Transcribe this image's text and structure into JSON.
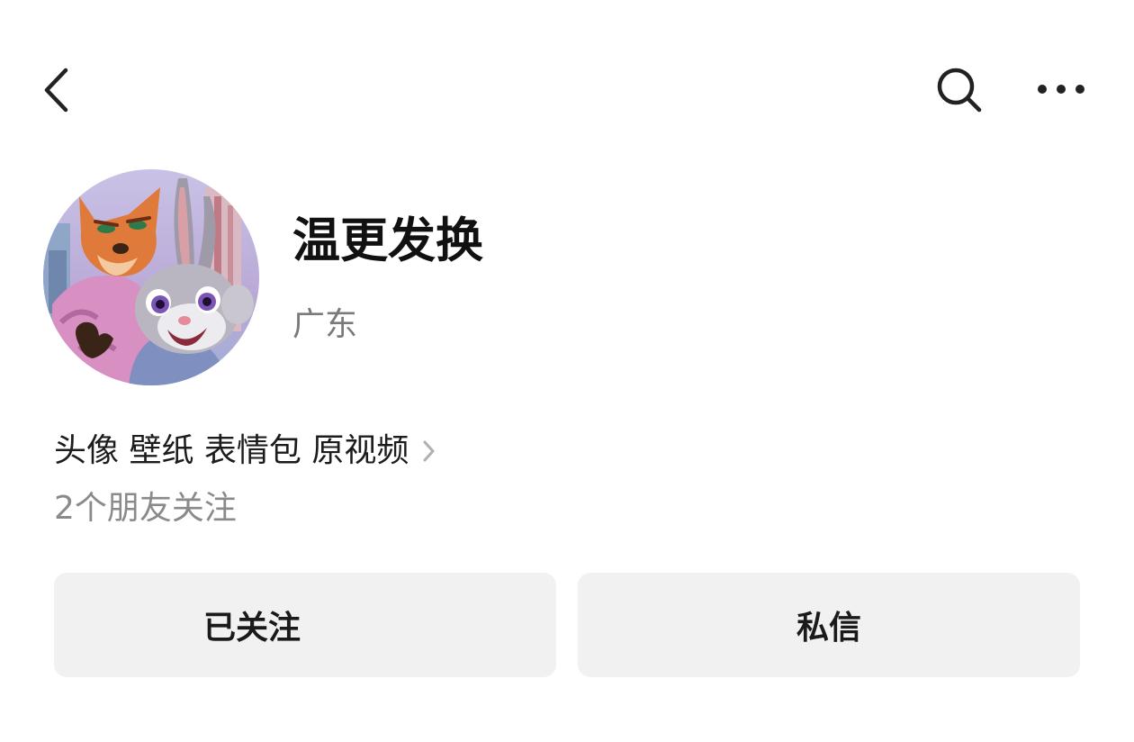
{
  "header": {
    "back_icon": "chevron-left-icon",
    "search_icon": "search-icon",
    "more_icon": "more-horizontal-icon"
  },
  "profile": {
    "avatar_icon": "zootopia-avatar",
    "nickname": "温更发换",
    "region": "广东",
    "bio": "头像 壁纸 表情包 原视频",
    "friends_following": "2个朋友关注"
  },
  "actions": {
    "follow_label": "已关注",
    "message_label": "私信"
  },
  "colors": {
    "background": "#ffffff",
    "button_bg": "#f1f1f1",
    "primary_text": "#111111",
    "secondary_text": "#8a8a8a"
  }
}
